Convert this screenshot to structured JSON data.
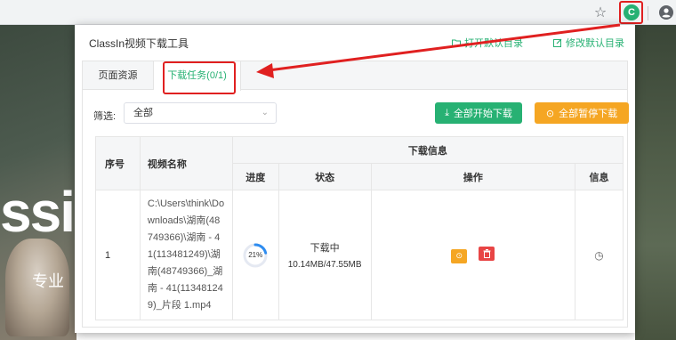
{
  "popup": {
    "title": "ClassIn视频下载工具",
    "open_dir_link": "打开默认目录",
    "edit_dir_link": "修改默认目录",
    "tabs": [
      {
        "label": "页面资源"
      },
      {
        "label": "下载任务(0/1)"
      }
    ],
    "filter": {
      "label": "筛选:",
      "value": "全部"
    },
    "buttons": {
      "start_all": "全部开始下载",
      "pause_all": "全部暂停下载"
    },
    "table": {
      "headers": {
        "no": "序号",
        "name": "视频名称",
        "download_info": "下载信息",
        "progress": "进度",
        "status": "状态",
        "actions": "操作",
        "info": "信息"
      },
      "rows": [
        {
          "no": "1",
          "name": "C:\\Users\\think\\Downloads\\湖南(48749366)\\湖南 - 41(113481249)\\湖南(48749366)_湖南 - 41(113481249)_片段 1.mp4",
          "progress_percent": 21,
          "progress_label": "21%",
          "status": "下载中",
          "size": "10.14MB/47.55MB"
        }
      ]
    }
  },
  "background": {
    "brand_text": "ssin",
    "slogan": "专业"
  },
  "icons": {
    "star": "star-icon",
    "extension": "classin-extension-icon",
    "account": "account-icon"
  },
  "colors": {
    "accent_green": "#27b173",
    "accent_orange": "#f5a623",
    "delete_red": "#e84545",
    "annotation_red": "#e02020"
  }
}
